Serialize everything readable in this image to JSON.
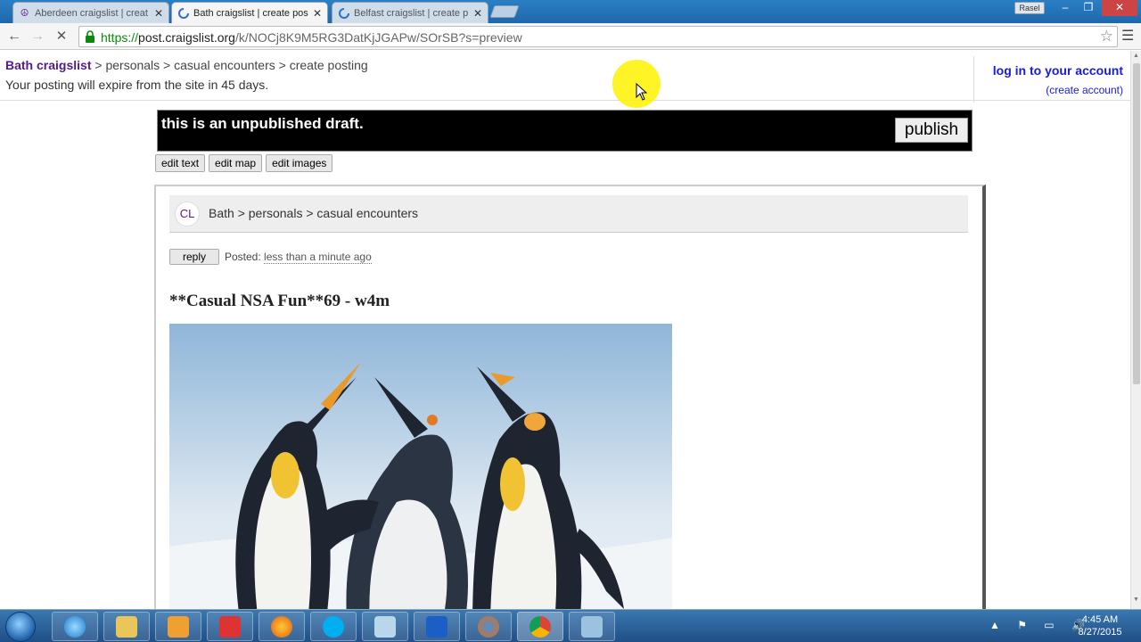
{
  "browser": {
    "tabs": [
      {
        "title": "Aberdeen craigslist | creat",
        "active": false
      },
      {
        "title": "Bath craigslist | create pos",
        "active": true
      },
      {
        "title": "Belfast craigslist | create p",
        "active": false
      }
    ],
    "user_badge": "Rasel",
    "url": {
      "scheme": "https://",
      "host": "post.craigslist.org",
      "path": "/k/NOCj8K9M5RG3DatKjJGAPw/SOrSB?s=preview"
    }
  },
  "header": {
    "site": "Bath craigslist",
    "sep1": " > ",
    "crumb1": "personals",
    "sep2": " > ",
    "crumb2": "casual encounters",
    "sep3": " > ",
    "crumb3": "create posting",
    "expire": "Your posting will expire from the site in 45 days.",
    "login": "log in to your account",
    "create_account": "(create account)"
  },
  "draft": {
    "message": "this is an unpublished draft.",
    "publish_label": "publish",
    "edit_text": "edit text",
    "edit_map": "edit map",
    "edit_images": "edit images"
  },
  "posting": {
    "logo": "CL",
    "breadcrumb": "Bath > personals > casual encounters",
    "reply_label": "reply",
    "posted_label": "Posted: ",
    "posted_time": "less than a minute ago",
    "title": "**Casual NSA Fun**69 - w4m"
  },
  "taskbar": {
    "time": "4:45 AM",
    "date": "8/27/2015"
  },
  "colors": {
    "link": "#1a1adc",
    "site_link": "#551a8b",
    "draft_bg": "#000000",
    "taskbar": "#1f4f86"
  }
}
